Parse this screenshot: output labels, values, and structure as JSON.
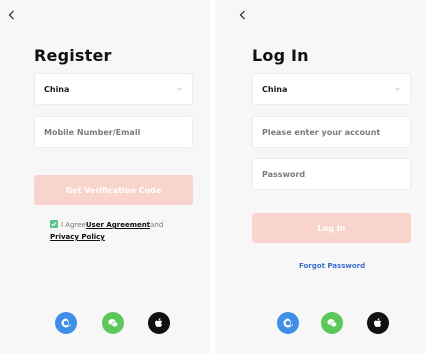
{
  "register": {
    "title": "Register",
    "region": "China",
    "account_placeholder": "Mobile Number/Email",
    "get_code_label": "Get Verification Code",
    "agree_prefix": "I Agree",
    "user_agreement": "User Agreement",
    "and_text": "and",
    "privacy_policy": "Privacy Policy"
  },
  "login": {
    "title": "Log In",
    "region": "China",
    "account_placeholder": "Please enter your account",
    "password_placeholder": "Password",
    "login_label": "Log In",
    "forgot_label": "Forgot Password"
  },
  "social_icons": [
    "alexa-icon",
    "wechat-icon",
    "apple-icon"
  ],
  "colors": {
    "primary_disabled": "#f9d4cc",
    "link_blue": "#3b6fd0",
    "check_green": "#5cc38f",
    "alexa_blue": "#3d8fe8",
    "wechat_green": "#5cc75b",
    "apple_black": "#111111"
  }
}
